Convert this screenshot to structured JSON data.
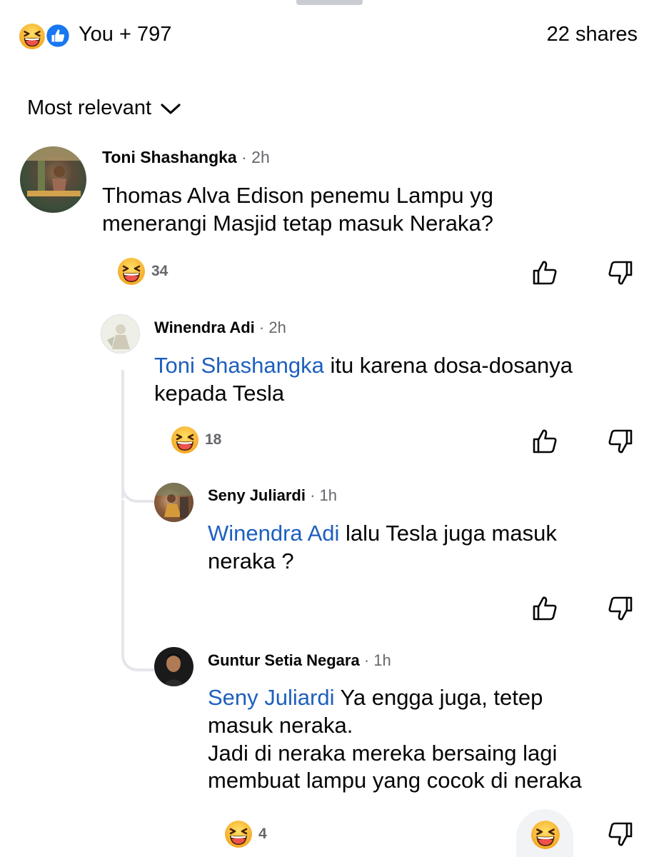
{
  "reactions_summary": {
    "count_text": "You + 797",
    "shares_text": "22 shares"
  },
  "sort": {
    "label": "Most relevant"
  },
  "comments": [
    {
      "author": "Toni Shashangka",
      "time": "· 2h",
      "text": "Thomas Alva Edison penemu Lampu yg\nmenerangi Masjid tetap masuk Neraka?",
      "reaction_count": "34"
    },
    {
      "author": "Winendra Adi",
      "time": "· 2h",
      "mention": "Toni Shashangka",
      "text": " itu karena dosa-dosanya\nkepada Tesla",
      "reaction_count": "18"
    },
    {
      "author": "Seny Juliardi",
      "time": "· 1h",
      "mention": "Winendra Adi",
      "text": " lalu Tesla juga masuk\nneraka ?"
    },
    {
      "author": "Guntur Setia Negara",
      "time": "· 1h",
      "mention": "Seny Juliardi",
      "text": " Ya engga juga, tetep\nmasuk neraka.\nJadi di neraka mereka bersaing lagi\nmembuat lampu yang cocok di neraka",
      "reaction_count": "4"
    }
  ],
  "colors": {
    "mention": "#1d5fbf",
    "meta": "#65676b",
    "thread_line": "#e4e6eb",
    "haha": "#f7b125",
    "like": "#1877f2"
  },
  "icons": [
    "haha-emoji-icon",
    "like-reaction-icon",
    "chevron-down-icon",
    "thumbs-up-icon",
    "thumbs-down-icon"
  ]
}
